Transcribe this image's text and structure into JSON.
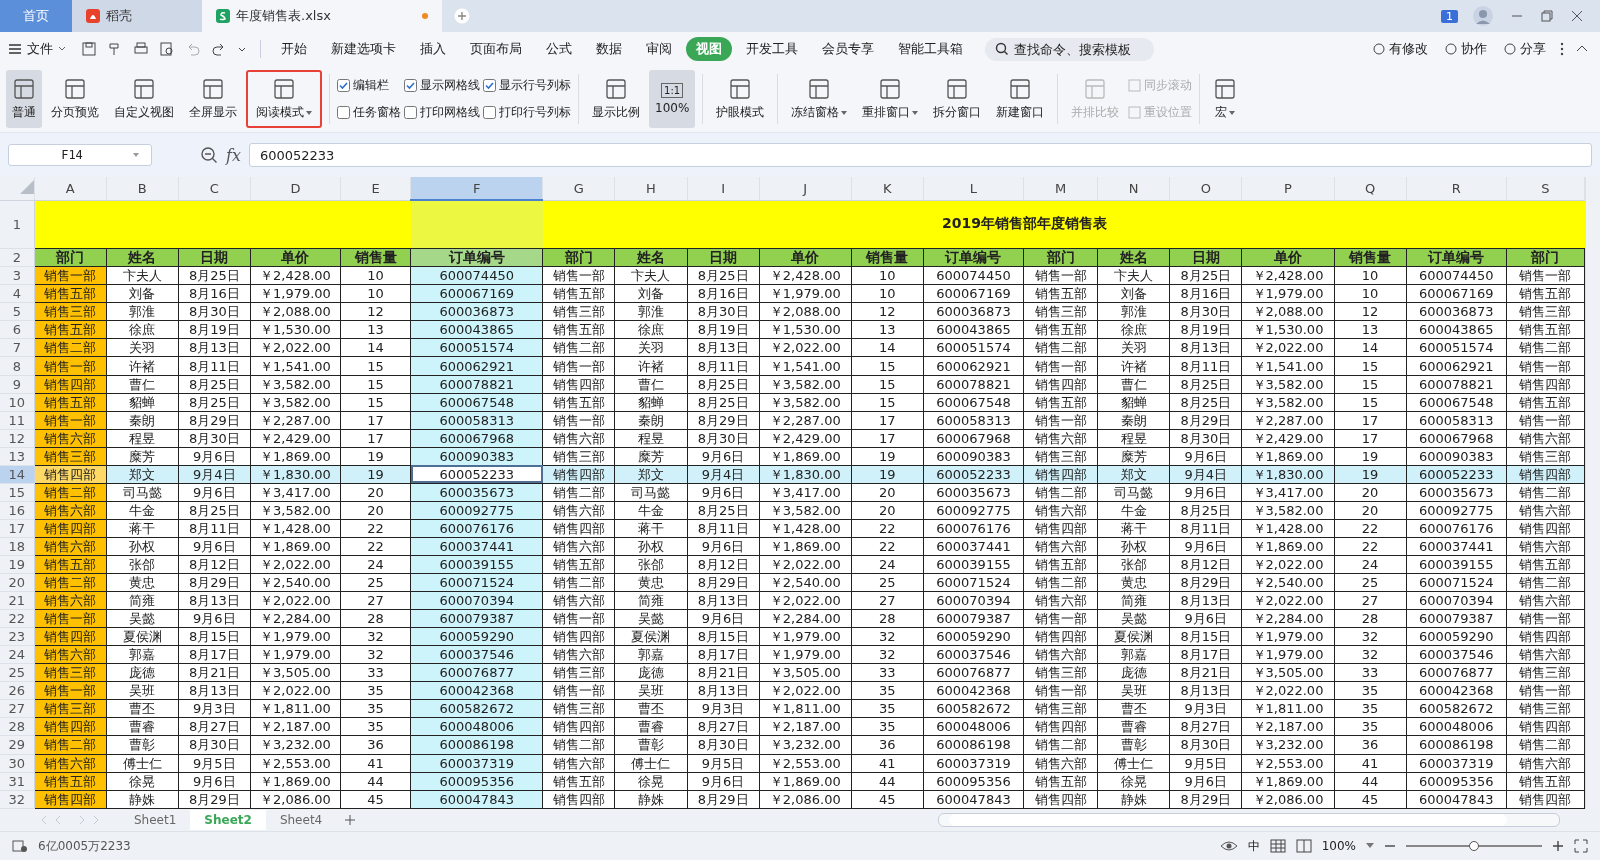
{
  "title_tabs": [
    {
      "kind": "home",
      "label": "首页",
      "selected": false,
      "modified": false
    },
    {
      "kind": "docer",
      "label": "稻壳",
      "selected": false,
      "modified": false
    },
    {
      "kind": "sheet",
      "label": "年度销售表.xlsx",
      "selected": true,
      "modified": true
    }
  ],
  "window_badge": "1",
  "menu": {
    "file": "文件",
    "tabs": [
      {
        "label": "开始",
        "selected": false
      },
      {
        "label": "新建选项卡",
        "selected": false
      },
      {
        "label": "插入",
        "selected": false
      },
      {
        "label": "页面布局",
        "selected": false
      },
      {
        "label": "公式",
        "selected": false
      },
      {
        "label": "数据",
        "selected": false
      },
      {
        "label": "审阅",
        "selected": false
      },
      {
        "label": "视图",
        "selected": true
      },
      {
        "label": "开发工具",
        "selected": false
      },
      {
        "label": "会员专享",
        "selected": false
      },
      {
        "label": "智能工具箱",
        "selected": false
      }
    ],
    "search": {
      "placeholder": "查找命令、搜索模板"
    },
    "right": [
      "有修改",
      "协作",
      "分享"
    ]
  },
  "ribbon": [
    {
      "kind": "button",
      "label": "普通",
      "selected": true,
      "dropdown": false,
      "disabled": false,
      "marked": false
    },
    {
      "kind": "button",
      "label": "分页预览",
      "selected": false,
      "dropdown": false,
      "disabled": false,
      "marked": false
    },
    {
      "kind": "button",
      "label": "自定义视图",
      "selected": false,
      "dropdown": false,
      "disabled": false,
      "marked": false
    },
    {
      "kind": "button",
      "label": "全屏显示",
      "selected": false,
      "dropdown": false,
      "disabled": false,
      "marked": false
    },
    {
      "kind": "button",
      "label": "阅读模式",
      "selected": false,
      "dropdown": true,
      "disabled": false,
      "marked": true
    },
    {
      "kind": "sep"
    },
    {
      "kind": "checks",
      "items": [
        {
          "label": "编辑栏",
          "checked": true
        },
        {
          "label": "任务窗格",
          "checked": false
        }
      ]
    },
    {
      "kind": "checks",
      "items": [
        {
          "label": "显示网格线",
          "checked": true
        },
        {
          "label": "打印网格线",
          "checked": false
        }
      ]
    },
    {
      "kind": "checks",
      "items": [
        {
          "label": "显示行号列标",
          "checked": true
        },
        {
          "label": "打印行号列标",
          "checked": false
        }
      ]
    },
    {
      "kind": "sep"
    },
    {
      "kind": "button",
      "label": "显示比例",
      "selected": false,
      "dropdown": false,
      "disabled": false,
      "marked": false
    },
    {
      "kind": "ratio",
      "label": "100%",
      "badge": "1:1",
      "selected": true
    },
    {
      "kind": "sep"
    },
    {
      "kind": "button",
      "label": "护眼模式",
      "selected": false,
      "dropdown": false,
      "disabled": false,
      "marked": false
    },
    {
      "kind": "sep"
    },
    {
      "kind": "button",
      "label": "冻结窗格",
      "selected": false,
      "dropdown": true,
      "disabled": false,
      "marked": false
    },
    {
      "kind": "button",
      "label": "重排窗口",
      "selected": false,
      "dropdown": true,
      "disabled": false,
      "marked": false
    },
    {
      "kind": "button",
      "label": "拆分窗口",
      "selected": false,
      "dropdown": false,
      "disabled": false,
      "marked": false
    },
    {
      "kind": "button",
      "label": "新建窗口",
      "selected": false,
      "dropdown": false,
      "disabled": false,
      "marked": false
    },
    {
      "kind": "sep"
    },
    {
      "kind": "button",
      "label": "并排比较",
      "selected": false,
      "dropdown": false,
      "disabled": true,
      "marked": false
    },
    {
      "kind": "smalls",
      "items": [
        {
          "label": "同步滚动",
          "disabled": true
        },
        {
          "label": "重设位置",
          "disabled": true
        }
      ]
    },
    {
      "kind": "sep"
    },
    {
      "kind": "button",
      "label": "宏",
      "selected": false,
      "dropdown": true,
      "disabled": false,
      "marked": false
    }
  ],
  "formula_bar": {
    "cell_ref": "F14",
    "fx": "fx",
    "value": "600052233"
  },
  "columns": [
    {
      "label": "A",
      "selected": false
    },
    {
      "label": "B",
      "selected": false
    },
    {
      "label": "C",
      "selected": false
    },
    {
      "label": "D",
      "selected": false
    },
    {
      "label": "E",
      "selected": false
    },
    {
      "label": "F",
      "selected": true
    },
    {
      "label": "G",
      "selected": false
    },
    {
      "label": "H",
      "selected": false
    },
    {
      "label": "I",
      "selected": false
    },
    {
      "label": "J",
      "selected": false
    },
    {
      "label": "K",
      "selected": false
    },
    {
      "label": "L",
      "selected": false
    },
    {
      "label": "M",
      "selected": false
    },
    {
      "label": "N",
      "selected": false
    },
    {
      "label": "O",
      "selected": false
    },
    {
      "label": "P",
      "selected": false
    },
    {
      "label": "Q",
      "selected": false
    },
    {
      "label": "R",
      "selected": false
    },
    {
      "label": "S",
      "selected": false
    }
  ],
  "title_row": {
    "n": "1",
    "title": "2019年销售部年度销售表"
  },
  "header_row": {
    "n": "2",
    "cells": [
      "部门",
      "姓名",
      "日期",
      "单价",
      "销售量",
      "订单编号",
      "部门",
      "姓名",
      "日期",
      "单价",
      "销售量",
      "订单编号",
      "部门",
      "姓名",
      "日期",
      "单价",
      "销售量",
      "订单编号",
      "部门"
    ]
  },
  "rows": [
    {
      "n": "3",
      "selected": false,
      "cells": [
        "销售一部",
        "卞夫人",
        "8月25日",
        "￥2,428.00",
        "10",
        "600074450",
        "销售一部",
        "卞夫人",
        "8月25日",
        "￥2,428.00",
        "10",
        "600074450",
        "销售一部",
        "卞夫人",
        "8月25日",
        "￥2,428.00",
        "10",
        "600074450",
        "销售一部"
      ]
    },
    {
      "n": "4",
      "selected": false,
      "cells": [
        "销售五部",
        "刘备",
        "8月16日",
        "￥1,979.00",
        "10",
        "600067169",
        "销售五部",
        "刘备",
        "8月16日",
        "￥1,979.00",
        "10",
        "600067169",
        "销售五部",
        "刘备",
        "8月16日",
        "￥1,979.00",
        "10",
        "600067169",
        "销售五部"
      ]
    },
    {
      "n": "5",
      "selected": false,
      "cells": [
        "销售三部",
        "郭淮",
        "8月30日",
        "￥2,088.00",
        "12",
        "600036873",
        "销售三部",
        "郭淮",
        "8月30日",
        "￥2,088.00",
        "12",
        "600036873",
        "销售三部",
        "郭淮",
        "8月30日",
        "￥2,088.00",
        "12",
        "600036873",
        "销售三部"
      ]
    },
    {
      "n": "6",
      "selected": false,
      "cells": [
        "销售五部",
        "徐庶",
        "8月19日",
        "￥1,530.00",
        "13",
        "600043865",
        "销售五部",
        "徐庶",
        "8月19日",
        "￥1,530.00",
        "13",
        "600043865",
        "销售五部",
        "徐庶",
        "8月19日",
        "￥1,530.00",
        "13",
        "600043865",
        "销售五部"
      ]
    },
    {
      "n": "7",
      "selected": false,
      "cells": [
        "销售二部",
        "关羽",
        "8月13日",
        "￥2,022.00",
        "14",
        "600051574",
        "销售二部",
        "关羽",
        "8月13日",
        "￥2,022.00",
        "14",
        "600051574",
        "销售二部",
        "关羽",
        "8月13日",
        "￥2,022.00",
        "14",
        "600051574",
        "销售二部"
      ]
    },
    {
      "n": "8",
      "selected": false,
      "cells": [
        "销售一部",
        "许褚",
        "8月11日",
        "￥1,541.00",
        "15",
        "600062921",
        "销售一部",
        "许褚",
        "8月11日",
        "￥1,541.00",
        "15",
        "600062921",
        "销售一部",
        "许褚",
        "8月11日",
        "￥1,541.00",
        "15",
        "600062921",
        "销售一部"
      ]
    },
    {
      "n": "9",
      "selected": false,
      "cells": [
        "销售四部",
        "曹仁",
        "8月25日",
        "￥3,582.00",
        "15",
        "600078821",
        "销售四部",
        "曹仁",
        "8月25日",
        "￥3,582.00",
        "15",
        "600078821",
        "销售四部",
        "曹仁",
        "8月25日",
        "￥3,582.00",
        "15",
        "600078821",
        "销售四部"
      ]
    },
    {
      "n": "10",
      "selected": false,
      "cells": [
        "销售五部",
        "貂蝉",
        "8月25日",
        "￥3,582.00",
        "15",
        "600067548",
        "销售五部",
        "貂蝉",
        "8月25日",
        "￥3,582.00",
        "15",
        "600067548",
        "销售五部",
        "貂蝉",
        "8月25日",
        "￥3,582.00",
        "15",
        "600067548",
        "销售五部"
      ]
    },
    {
      "n": "11",
      "selected": false,
      "cells": [
        "销售一部",
        "秦朗",
        "8月29日",
        "￥2,287.00",
        "17",
        "600058313",
        "销售一部",
        "秦朗",
        "8月29日",
        "￥2,287.00",
        "17",
        "600058313",
        "销售一部",
        "秦朗",
        "8月29日",
        "￥2,287.00",
        "17",
        "600058313",
        "销售一部"
      ]
    },
    {
      "n": "12",
      "selected": false,
      "cells": [
        "销售六部",
        "程昱",
        "8月30日",
        "￥2,429.00",
        "17",
        "600067968",
        "销售六部",
        "程昱",
        "8月30日",
        "￥2,429.00",
        "17",
        "600067968",
        "销售六部",
        "程昱",
        "8月30日",
        "￥2,429.00",
        "17",
        "600067968",
        "销售六部"
      ]
    },
    {
      "n": "13",
      "selected": false,
      "cells": [
        "销售三部",
        "糜芳",
        "9月6日",
        "￥1,869.00",
        "19",
        "600090383",
        "销售三部",
        "糜芳",
        "9月6日",
        "￥1,869.00",
        "19",
        "600090383",
        "销售三部",
        "糜芳",
        "9月6日",
        "￥1,869.00",
        "19",
        "600090383",
        "销售三部"
      ]
    },
    {
      "n": "14",
      "selected": true,
      "cells": [
        "销售四部",
        "郑文",
        "9月4日",
        "￥1,830.00",
        "19",
        "600052233",
        "销售四部",
        "郑文",
        "9月4日",
        "￥1,830.00",
        "19",
        "600052233",
        "销售四部",
        "郑文",
        "9月4日",
        "￥1,830.00",
        "19",
        "600052233",
        "销售四部"
      ]
    },
    {
      "n": "15",
      "selected": false,
      "cells": [
        "销售二部",
        "司马懿",
        "9月6日",
        "￥3,417.00",
        "20",
        "600035673",
        "销售二部",
        "司马懿",
        "9月6日",
        "￥3,417.00",
        "20",
        "600035673",
        "销售二部",
        "司马懿",
        "9月6日",
        "￥3,417.00",
        "20",
        "600035673",
        "销售二部"
      ]
    },
    {
      "n": "16",
      "selected": false,
      "cells": [
        "销售六部",
        "牛金",
        "8月25日",
        "￥3,582.00",
        "20",
        "600092775",
        "销售六部",
        "牛金",
        "8月25日",
        "￥3,582.00",
        "20",
        "600092775",
        "销售六部",
        "牛金",
        "8月25日",
        "￥3,582.00",
        "20",
        "600092775",
        "销售六部"
      ]
    },
    {
      "n": "17",
      "selected": false,
      "cells": [
        "销售四部",
        "蒋干",
        "8月11日",
        "￥1,428.00",
        "22",
        "600076176",
        "销售四部",
        "蒋干",
        "8月11日",
        "￥1,428.00",
        "22",
        "600076176",
        "销售四部",
        "蒋干",
        "8月11日",
        "￥1,428.00",
        "22",
        "600076176",
        "销售四部"
      ]
    },
    {
      "n": "18",
      "selected": false,
      "cells": [
        "销售六部",
        "孙权",
        "9月6日",
        "￥1,869.00",
        "22",
        "600037441",
        "销售六部",
        "孙权",
        "9月6日",
        "￥1,869.00",
        "22",
        "600037441",
        "销售六部",
        "孙权",
        "9月6日",
        "￥1,869.00",
        "22",
        "600037441",
        "销售六部"
      ]
    },
    {
      "n": "19",
      "selected": false,
      "cells": [
        "销售五部",
        "张郃",
        "8月12日",
        "￥2,022.00",
        "24",
        "600039155",
        "销售五部",
        "张郃",
        "8月12日",
        "￥2,022.00",
        "24",
        "600039155",
        "销售五部",
        "张郃",
        "8月12日",
        "￥2,022.00",
        "24",
        "600039155",
        "销售五部"
      ]
    },
    {
      "n": "20",
      "selected": false,
      "cells": [
        "销售二部",
        "黄忠",
        "8月29日",
        "￥2,540.00",
        "25",
        "600071524",
        "销售二部",
        "黄忠",
        "8月29日",
        "￥2,540.00",
        "25",
        "600071524",
        "销售二部",
        "黄忠",
        "8月29日",
        "￥2,540.00",
        "25",
        "600071524",
        "销售二部"
      ]
    },
    {
      "n": "21",
      "selected": false,
      "cells": [
        "销售六部",
        "简雍",
        "8月13日",
        "￥2,022.00",
        "27",
        "600070394",
        "销售六部",
        "简雍",
        "8月13日",
        "￥2,022.00",
        "27",
        "600070394",
        "销售六部",
        "简雍",
        "8月13日",
        "￥2,022.00",
        "27",
        "600070394",
        "销售六部"
      ]
    },
    {
      "n": "22",
      "selected": false,
      "cells": [
        "销售一部",
        "吴懿",
        "9月6日",
        "￥2,284.00",
        "28",
        "600079387",
        "销售一部",
        "吴懿",
        "9月6日",
        "￥2,284.00",
        "28",
        "600079387",
        "销售一部",
        "吴懿",
        "9月6日",
        "￥2,284.00",
        "28",
        "600079387",
        "销售一部"
      ]
    },
    {
      "n": "23",
      "selected": false,
      "cells": [
        "销售四部",
        "夏侯渊",
        "8月15日",
        "￥1,979.00",
        "32",
        "600059290",
        "销售四部",
        "夏侯渊",
        "8月15日",
        "￥1,979.00",
        "32",
        "600059290",
        "销售四部",
        "夏侯渊",
        "8月15日",
        "￥1,979.00",
        "32",
        "600059290",
        "销售四部"
      ]
    },
    {
      "n": "24",
      "selected": false,
      "cells": [
        "销售六部",
        "郭嘉",
        "8月17日",
        "￥1,979.00",
        "32",
        "600037546",
        "销售六部",
        "郭嘉",
        "8月17日",
        "￥1,979.00",
        "32",
        "600037546",
        "销售六部",
        "郭嘉",
        "8月17日",
        "￥1,979.00",
        "32",
        "600037546",
        "销售六部"
      ]
    },
    {
      "n": "25",
      "selected": false,
      "cells": [
        "销售三部",
        "庞德",
        "8月21日",
        "￥3,505.00",
        "33",
        "600076877",
        "销售三部",
        "庞德",
        "8月21日",
        "￥3,505.00",
        "33",
        "600076877",
        "销售三部",
        "庞德",
        "8月21日",
        "￥3,505.00",
        "33",
        "600076877",
        "销售三部"
      ]
    },
    {
      "n": "26",
      "selected": false,
      "cells": [
        "销售一部",
        "吴班",
        "8月13日",
        "￥2,022.00",
        "35",
        "600042368",
        "销售一部",
        "吴班",
        "8月13日",
        "￥2,022.00",
        "35",
        "600042368",
        "销售一部",
        "吴班",
        "8月13日",
        "￥2,022.00",
        "35",
        "600042368",
        "销售一部"
      ]
    },
    {
      "n": "27",
      "selected": false,
      "cells": [
        "销售三部",
        "曹丕",
        "9月3日",
        "￥1,811.00",
        "35",
        "600582672",
        "销售三部",
        "曹丕",
        "9月3日",
        "￥1,811.00",
        "35",
        "600582672",
        "销售三部",
        "曹丕",
        "9月3日",
        "￥1,811.00",
        "35",
        "600582672",
        "销售三部"
      ]
    },
    {
      "n": "28",
      "selected": false,
      "cells": [
        "销售四部",
        "曹睿",
        "8月27日",
        "￥2,187.00",
        "35",
        "600048006",
        "销售四部",
        "曹睿",
        "8月27日",
        "￥2,187.00",
        "35",
        "600048006",
        "销售四部",
        "曹睿",
        "8月27日",
        "￥2,187.00",
        "35",
        "600048006",
        "销售四部"
      ]
    },
    {
      "n": "29",
      "selected": false,
      "cells": [
        "销售二部",
        "曹彰",
        "8月30日",
        "￥3,232.00",
        "36",
        "600086198",
        "销售二部",
        "曹彰",
        "8月30日",
        "￥3,232.00",
        "36",
        "600086198",
        "销售二部",
        "曹彰",
        "8月30日",
        "￥3,232.00",
        "36",
        "600086198",
        "销售二部"
      ]
    },
    {
      "n": "30",
      "selected": false,
      "cells": [
        "销售六部",
        "傅士仁",
        "9月5日",
        "￥2,553.00",
        "41",
        "600037319",
        "销售六部",
        "傅士仁",
        "9月5日",
        "￥2,553.00",
        "41",
        "600037319",
        "销售六部",
        "傅士仁",
        "9月5日",
        "￥2,553.00",
        "41",
        "600037319",
        "销售六部"
      ]
    },
    {
      "n": "31",
      "selected": false,
      "cells": [
        "销售五部",
        "徐晃",
        "9月6日",
        "￥1,869.00",
        "44",
        "600095356",
        "销售五部",
        "徐晃",
        "9月6日",
        "￥1,869.00",
        "44",
        "600095356",
        "销售五部",
        "徐晃",
        "9月6日",
        "￥1,869.00",
        "44",
        "600095356",
        "销售五部"
      ]
    },
    {
      "n": "32",
      "selected": false,
      "cells": [
        "销售四部",
        "静姝",
        "8月29日",
        "￥2,086.00",
        "45",
        "600047843",
        "销售四部",
        "静姝",
        "8月29日",
        "￥2,086.00",
        "45",
        "600047843",
        "销售四部",
        "静姝",
        "8月29日",
        "￥2,086.00",
        "45",
        "600047843",
        "销售四部"
      ]
    }
  ],
  "sheets": [
    {
      "label": "Sheet1",
      "selected": false
    },
    {
      "label": "Sheet2",
      "selected": true
    },
    {
      "label": "Sheet4",
      "selected": false
    }
  ],
  "status_bar": {
    "text": "6亿0005万2233",
    "ime": "中",
    "zoom": "100%",
    "zoom_slider": {
      "level": 0.5
    }
  }
}
